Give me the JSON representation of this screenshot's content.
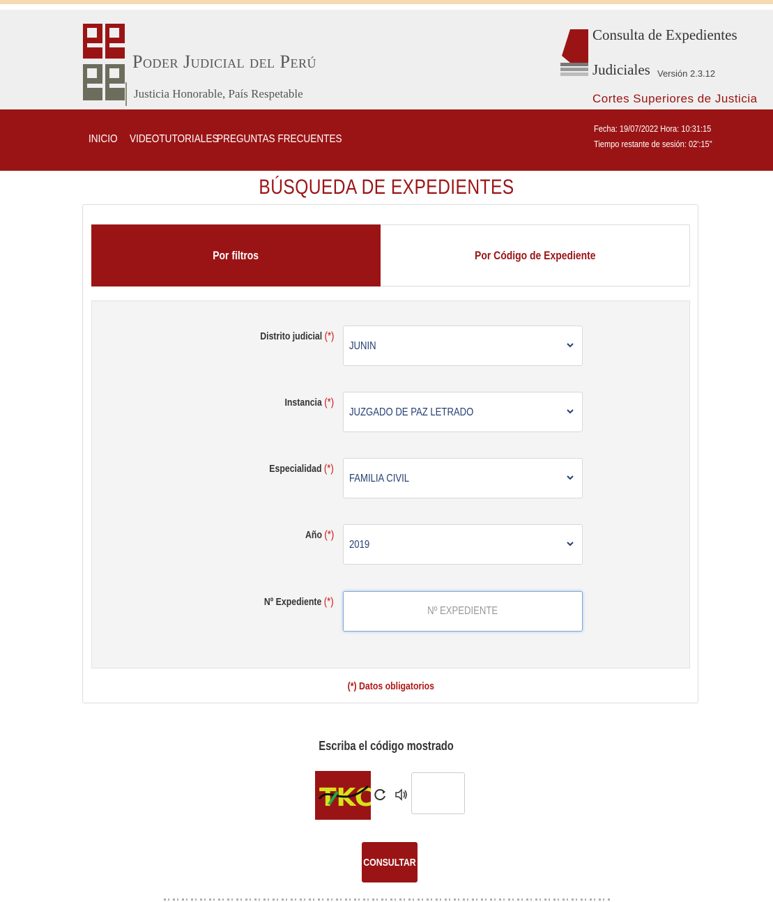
{
  "header": {
    "logo_title": "Poder Judicial del Perú",
    "logo_subtitle": "Justicia Honorable, País Respetable",
    "app_title_line1": "Consulta de Expedientes",
    "app_title_line2": "Judiciales",
    "app_version": "Versión 2.3.12",
    "app_scope": "Cortes Superiores de Justicia"
  },
  "nav": {
    "items": [
      {
        "label": "INICIO"
      },
      {
        "label": "VIDEOTUTORIALES"
      },
      {
        "label": "PREGUNTAS FRECUENTES"
      }
    ],
    "fecha": "Fecha: 19/07/2022 Hora: 10:31:15",
    "tiempo": "Tiempo restante de sesión: 02':15\""
  },
  "page_title": "BÚSQUEDA DE EXPEDIENTES",
  "tabs": [
    {
      "label": "Por filtros",
      "active": true
    },
    {
      "label": "Por Código de Expediente",
      "active": false
    }
  ],
  "form": {
    "required_marker": "(*)",
    "fields": [
      {
        "label": "Distrito judicial",
        "value": "JUNIN"
      },
      {
        "label": "Instancia",
        "value": "JUZGADO DE PAZ LETRADO"
      },
      {
        "label": "Especialidad",
        "value": "FAMILIA CIVIL"
      },
      {
        "label": "Año",
        "value": "2019"
      }
    ],
    "expediente_label": "Nº Expediente",
    "expediente_placeholder": "Nº EXPEDIENTE",
    "required_note": "(*) Datos obligatorios"
  },
  "captcha": {
    "label": "Escriba el código mostrado",
    "code": "TKCA"
  },
  "submit_label": "CONSULTAR",
  "colors": {
    "brand": "#9b1415",
    "header_bg": "#efefef",
    "required": "#cc1111"
  }
}
